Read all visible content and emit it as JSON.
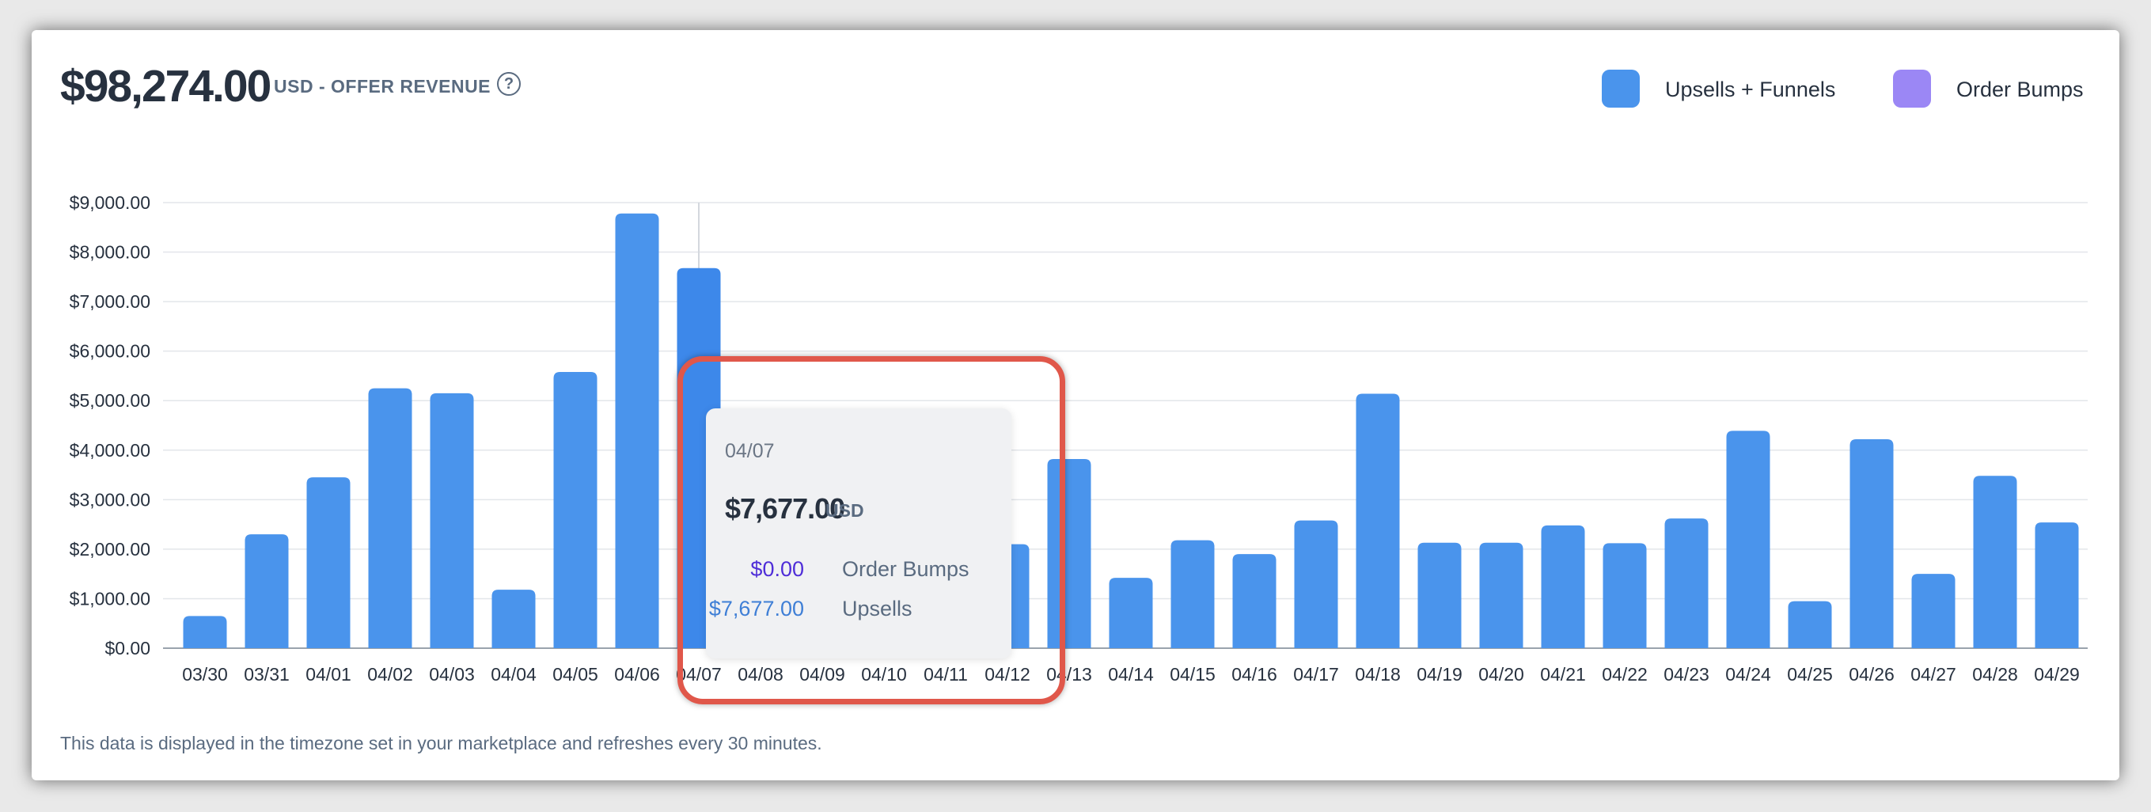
{
  "header": {
    "total": "$98,274.00",
    "subtitle": "USD - OFFER REVENUE",
    "help_icon": "question-circle-icon"
  },
  "legend": [
    {
      "label": "Upsells + Funnels",
      "color": "#4a94ec"
    },
    {
      "label": "Order Bumps",
      "color": "#9b87f5"
    }
  ],
  "chart_data": {
    "type": "bar",
    "stacked": true,
    "categories": [
      "03/30",
      "03/31",
      "04/01",
      "04/02",
      "04/03",
      "04/04",
      "04/05",
      "04/06",
      "04/07",
      "04/08",
      "04/09",
      "04/10",
      "04/11",
      "04/12",
      "04/13",
      "04/14",
      "04/15",
      "04/16",
      "04/17",
      "04/18",
      "04/19",
      "04/20",
      "04/21",
      "04/22",
      "04/23",
      "04/24",
      "04/25",
      "04/26",
      "04/27",
      "04/28",
      "04/29"
    ],
    "series": [
      {
        "name": "Upsells + Funnels",
        "color": "#4a94ec",
        "values": [
          650,
          2300,
          3450,
          5250,
          5150,
          1180,
          5580,
          8780,
          7677,
          0,
          0,
          0,
          0,
          2100,
          3820,
          1420,
          2180,
          1900,
          2580,
          5140,
          2130,
          2130,
          2480,
          2120,
          2620,
          4390,
          950,
          4220,
          1500,
          3480,
          2540
        ]
      },
      {
        "name": "Order Bumps",
        "color": "#9b87f5",
        "values": [
          0,
          0,
          0,
          0,
          0,
          0,
          0,
          0,
          0,
          0,
          0,
          0,
          0,
          0,
          0,
          0,
          0,
          0,
          0,
          0,
          0,
          0,
          0,
          0,
          0,
          0,
          0,
          0,
          0,
          0,
          0
        ]
      }
    ],
    "yticks": [
      "$0.00",
      "$1,000.00",
      "$2,000.00",
      "$3,000.00",
      "$4,000.00",
      "$5,000.00",
      "$6,000.00",
      "$7,000.00",
      "$8,000.00",
      "$9,000.00"
    ],
    "ylim": [
      0,
      9000
    ],
    "grid": true,
    "legend_position": "top-right",
    "hovered_category": "04/07"
  },
  "tooltip": {
    "date": "04/07",
    "total": "$7,677.00",
    "currency": "USD",
    "rows": [
      {
        "value": "$0.00",
        "label": "Order Bumps",
        "color": "#4f2ed8"
      },
      {
        "value": "$7,677.00",
        "label": "Upsells",
        "color": "#3f7fd6"
      }
    ]
  },
  "footer": "This data is displayed in the timezone set in your marketplace and refreshes every 30 minutes."
}
